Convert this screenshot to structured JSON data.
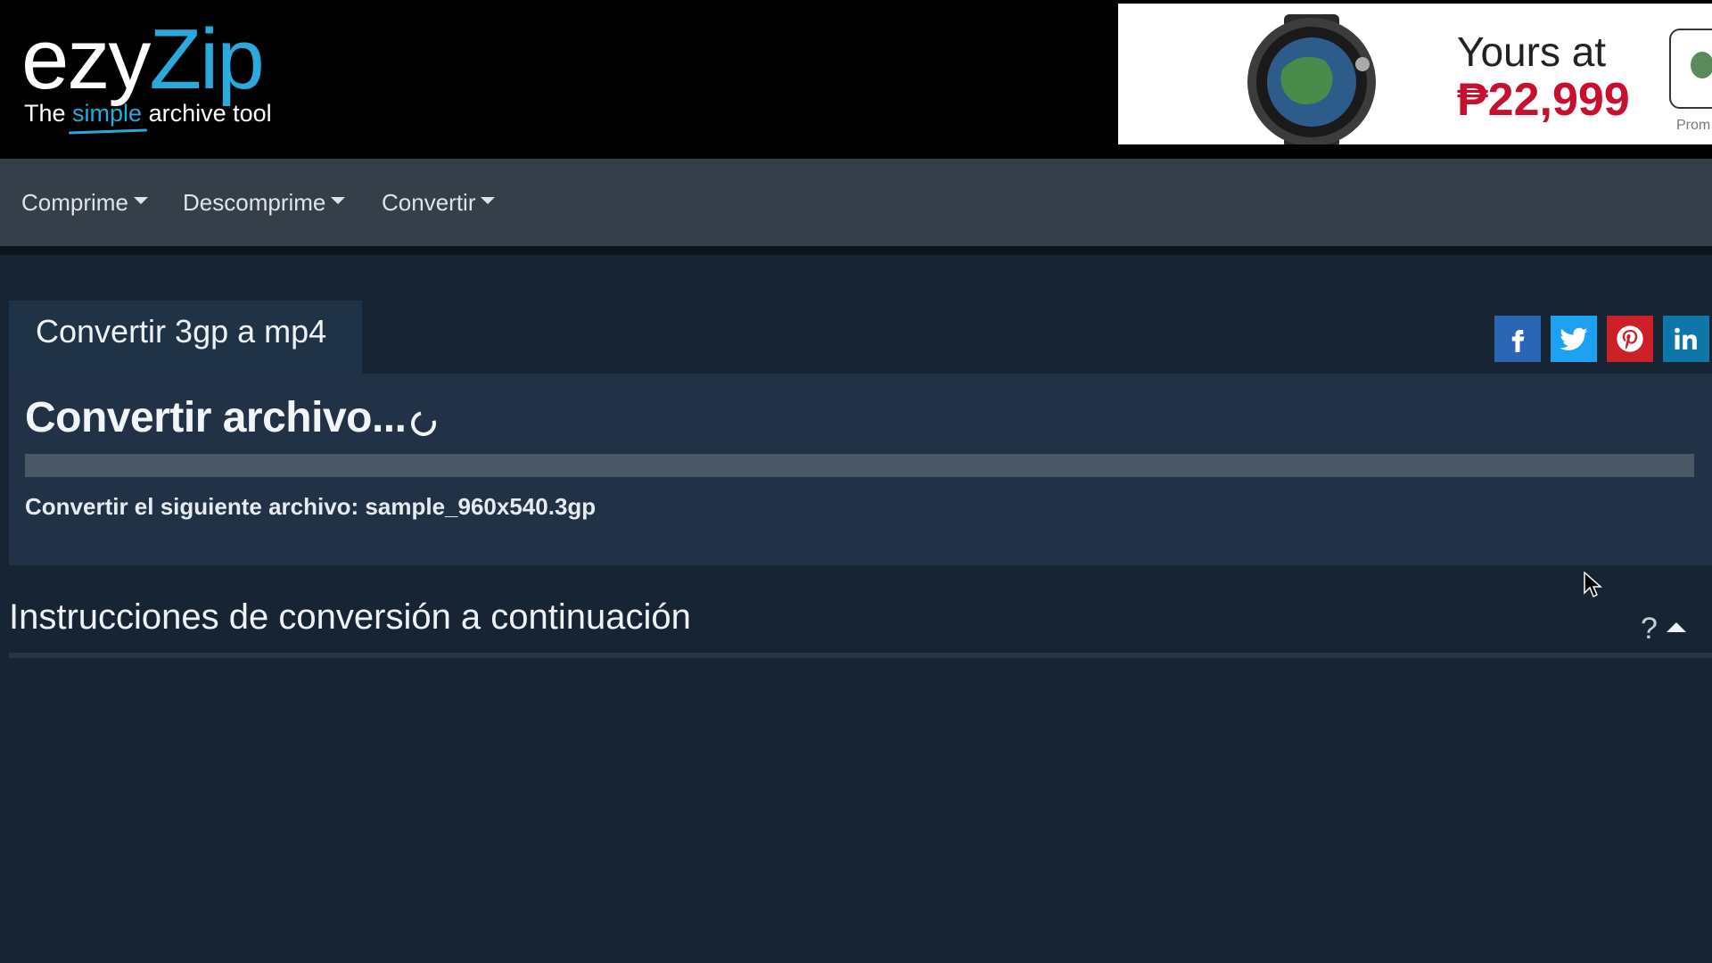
{
  "logo": {
    "part1": "ezy",
    "part2": "Zip",
    "tagline_pre": "The ",
    "tagline_highlight": "simple",
    "tagline_post": " archive tool"
  },
  "ad": {
    "line1": "Yours at",
    "line2": "₱22,999",
    "promo": "Prom"
  },
  "nav": {
    "items": [
      {
        "label": "Comprime"
      },
      {
        "label": "Descomprime"
      },
      {
        "label": "Convertir"
      }
    ]
  },
  "tab": {
    "label": "Convertir 3gp a mp4"
  },
  "social": [
    "facebook",
    "twitter",
    "pinterest",
    "linkedin"
  ],
  "panel": {
    "title": "Convertir archivo...",
    "progress": 0,
    "file_line": "Convertir el siguiente archivo: sample_960x540.3gp"
  },
  "instructions": {
    "title": "Instrucciones de conversión a continuación",
    "help": "?"
  },
  "colors": {
    "accent": "#29a9dc",
    "facebook": "#2a66b3",
    "twitter": "#1da1f2",
    "pinterest": "#cb2027",
    "linkedin": "#0e76a8",
    "background": "#162434",
    "nav": "#343f49"
  }
}
